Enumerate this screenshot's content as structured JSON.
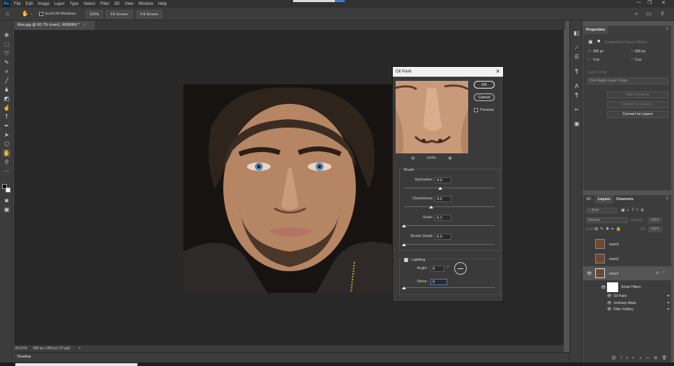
{
  "menubar": {
    "logo": "Ps",
    "items": [
      "File",
      "Edit",
      "Image",
      "Layer",
      "Type",
      "Select",
      "Filter",
      "3D",
      "View",
      "Window",
      "Help"
    ]
  },
  "options": {
    "scroll_all": "Scroll All Windows",
    "zoom": "100%",
    "fit_screen": "Fit Screen",
    "fill_screen": "Fill Screen"
  },
  "document": {
    "tab_title": "Man.jpg @ 66.7% (man1, RGB/8#) *",
    "close": "×"
  },
  "status": {
    "zoom": "66.67%",
    "size": "900 px x 900 px (72 ppi)",
    "arrow": ">"
  },
  "timeline": {
    "label": "Timeline"
  },
  "properties": {
    "title": "Properties",
    "object_type": "Embedded Smart Object",
    "w_label": "W:",
    "w_value": "900 px",
    "h_label": "H:",
    "h_value": "900 px",
    "x_label": "X:",
    "x_value": "0 px",
    "y_label": "Y:",
    "y_value": "0 px",
    "layer_comp_label": "Layer Comp",
    "layer_comp_value": "Don't Apply Layer Comp",
    "edit_contents": "Edit Contents",
    "convert_linked": "Convert to Linked...",
    "convert_layers": "Convert to Layers"
  },
  "layers_panel": {
    "tabs": [
      "3D",
      "Layers",
      "Channels"
    ],
    "kind": "Kind",
    "blend": "Normal",
    "opacity_label": "Opacity:",
    "opacity": "100%",
    "lock_label": "Lock:",
    "fill_label": "Fill:",
    "fill": "100%",
    "layers": [
      {
        "name": "man3",
        "visible": false
      },
      {
        "name": "man2",
        "visible": false
      },
      {
        "name": "man1",
        "visible": true
      }
    ],
    "smart_filters_label": "Smart Filters",
    "filters": [
      "Oil Paint",
      "Unsharp Mask",
      "Filter Gallery"
    ]
  },
  "dialog": {
    "title": "Oil Paint",
    "ok": "OK",
    "cancel": "Cancel",
    "preview_label": "Preview",
    "zoom": "100%",
    "brush_label": "Brush",
    "stylization_label": "Stylization:",
    "stylization": "4.0",
    "stylization_frac": 0.4,
    "cleanliness_label": "Cleanliness:",
    "cleanliness": "3.0",
    "cleanliness_frac": 0.3,
    "scale_label": "Scale:",
    "scale": "0.1",
    "scale_frac": 0.0,
    "bristle_label": "Bristle Detail:",
    "bristle": "0.0",
    "bristle_frac": 0.0,
    "lighting_label": "Lighting",
    "angle_label": "Angle:",
    "angle": "0",
    "degree": "°",
    "shine_label": "Shine:",
    "shine": "0",
    "shine_frac": 0.0
  }
}
